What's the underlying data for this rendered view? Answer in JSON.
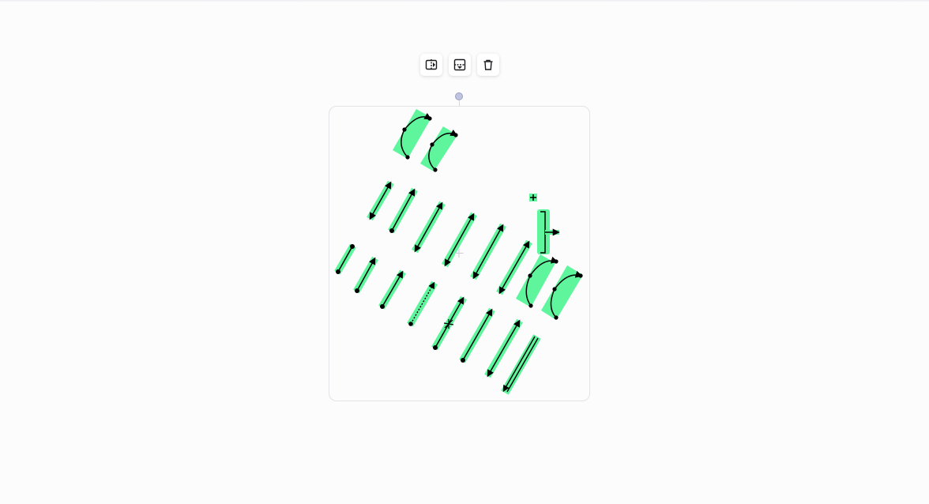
{
  "toolbar": {
    "buttons": [
      {
        "icon": "flip-horizontal-icon"
      },
      {
        "icon": "flip-vertical-icon"
      },
      {
        "icon": "trash-icon"
      }
    ]
  },
  "canvas": {
    "group_rotation_deg": 28,
    "colors": {
      "highlight": "#5ef59d",
      "stroke": "#000000",
      "frame": "#e3e3e8",
      "handle": "#c0c4dc"
    }
  }
}
